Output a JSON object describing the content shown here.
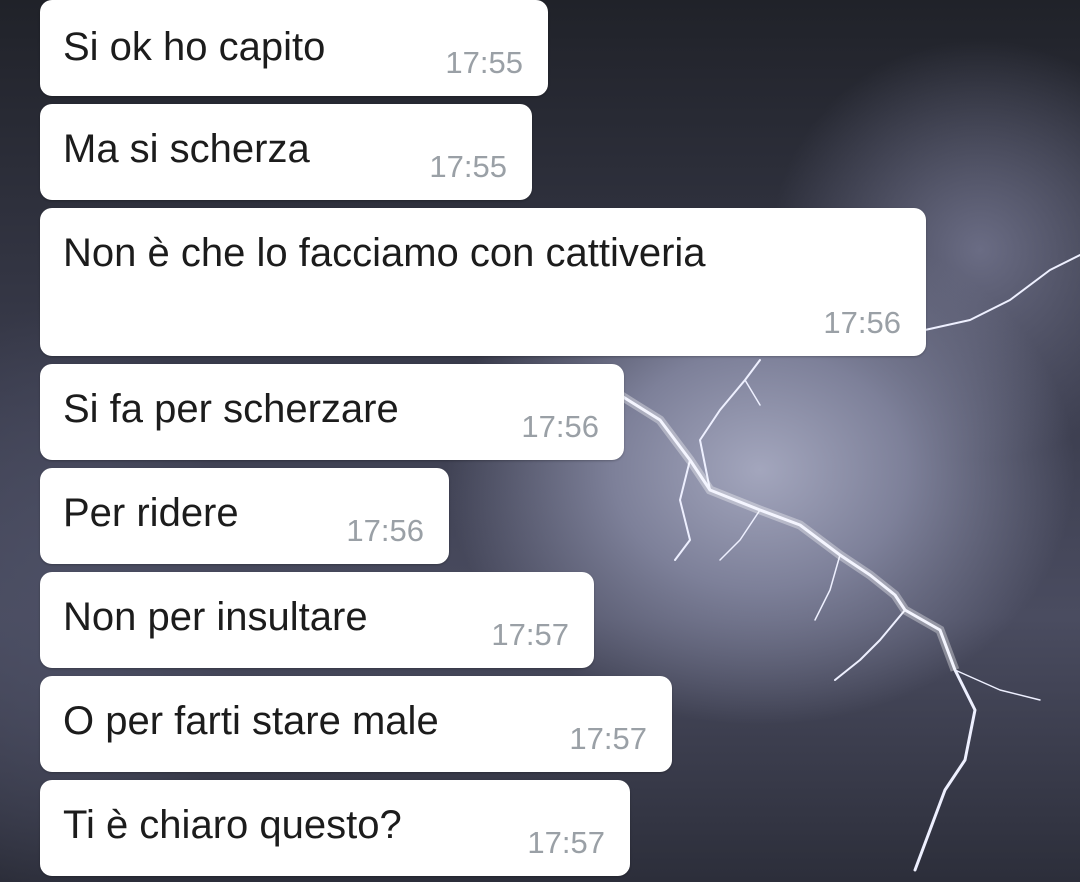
{
  "chat": {
    "messages": [
      {
        "text": "Si ok ho capito",
        "time": "17:55"
      },
      {
        "text": "Ma si scherza",
        "time": "17:55"
      },
      {
        "text": "Non è che lo facciamo con cattiveria",
        "time": "17:56"
      },
      {
        "text": "Si fa per scherzare",
        "time": "17:56"
      },
      {
        "text": "Per ridere",
        "time": "17:56"
      },
      {
        "text": "Non per insultare",
        "time": "17:57"
      },
      {
        "text": "O per farti stare male",
        "time": "17:57"
      },
      {
        "text": "Ti è chiaro questo?",
        "time": "17:57"
      }
    ]
  },
  "colors": {
    "bubble": "#ffffff",
    "message_text": "#1c1c1c",
    "timestamp": "#9aa0a6",
    "wallpaper": "#3b3d4e"
  },
  "icons": {
    "wallpaper": "lightning-storm-wallpaper"
  }
}
